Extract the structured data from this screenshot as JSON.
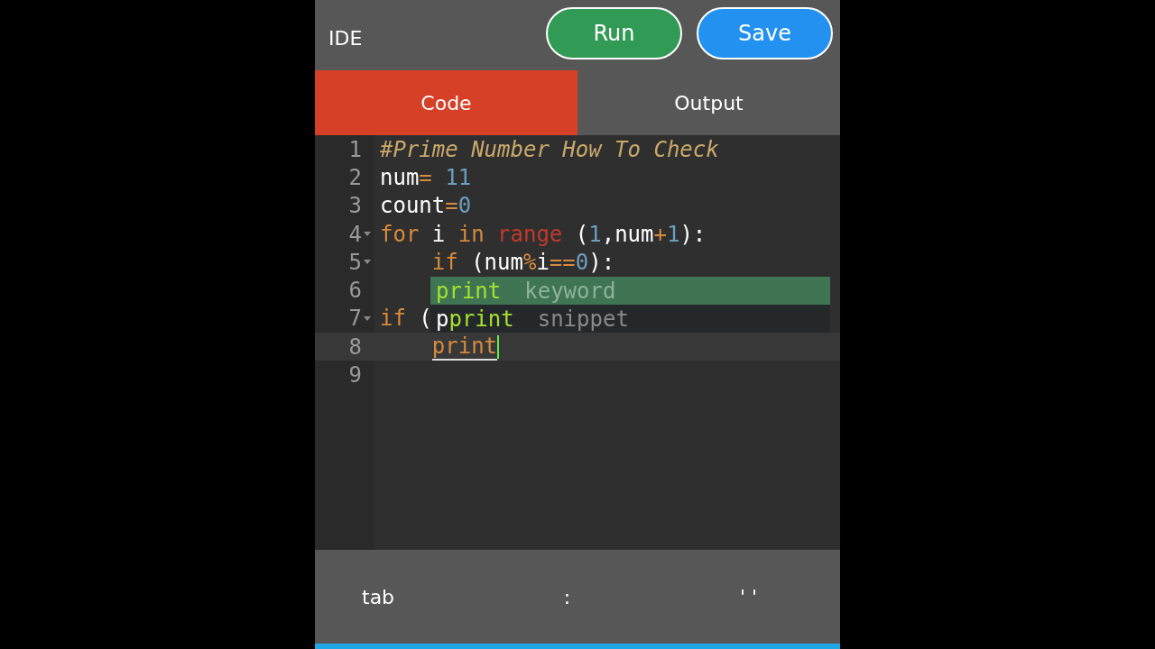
{
  "header": {
    "title": "IDE",
    "buttons": [
      {
        "label": "Run",
        "kind": "run"
      },
      {
        "label": "Save",
        "kind": "save"
      }
    ]
  },
  "tabs": [
    {
      "label": "Code",
      "selected": true
    },
    {
      "label": "Output",
      "selected": false
    }
  ],
  "editor": {
    "lines": [
      {
        "number": "1",
        "foldable": false,
        "active": false,
        "indented": false,
        "tokens": [
          {
            "text": "#Prime Number How To Check",
            "kind": "comment"
          }
        ]
      },
      {
        "number": "2",
        "foldable": false,
        "active": false,
        "indented": false,
        "tokens": [
          {
            "text": "num",
            "kind": "plain"
          },
          {
            "text": "=",
            "kind": "operator"
          },
          {
            "text": " 11",
            "kind": "number"
          }
        ]
      },
      {
        "number": "3",
        "foldable": false,
        "active": false,
        "indented": false,
        "tokens": [
          {
            "text": "count",
            "kind": "plain"
          },
          {
            "text": "=",
            "kind": "operator"
          },
          {
            "text": "0",
            "kind": "number"
          }
        ]
      },
      {
        "number": "4",
        "foldable": true,
        "active": false,
        "indented": false,
        "tokens": [
          {
            "text": "for",
            "kind": "keyword"
          },
          {
            "text": " i ",
            "kind": "plain"
          },
          {
            "text": "in",
            "kind": "keyword"
          },
          {
            "text": " range",
            "kind": "builtin"
          },
          {
            "text": " (",
            "kind": "plain"
          },
          {
            "text": "1",
            "kind": "number"
          },
          {
            "text": ",num",
            "kind": "plain"
          },
          {
            "text": "+",
            "kind": "operator"
          },
          {
            "text": "1",
            "kind": "number"
          },
          {
            "text": "):",
            "kind": "plain"
          }
        ]
      },
      {
        "number": "5",
        "foldable": true,
        "active": false,
        "indented": true,
        "tokens": [
          {
            "text": "if",
            "kind": "keyword"
          },
          {
            "text": " (num",
            "kind": "plain"
          },
          {
            "text": "%",
            "kind": "operator"
          },
          {
            "text": "i",
            "kind": "plain"
          },
          {
            "text": "==",
            "kind": "operator"
          },
          {
            "text": "0",
            "kind": "number"
          },
          {
            "text": "):",
            "kind": "plain"
          }
        ]
      },
      {
        "number": "6",
        "foldable": false,
        "active": false
      },
      {
        "number": "7",
        "foldable": true,
        "active": false,
        "indented": false,
        "tokens": [
          {
            "text": "if",
            "kind": "keyword"
          },
          {
            "text": " (",
            "kind": "plain"
          }
        ]
      },
      {
        "number": "8",
        "foldable": false,
        "active": true,
        "indented": true,
        "tokens": [
          {
            "text": "print",
            "kind": "typed"
          }
        ]
      },
      {
        "number": "9",
        "foldable": false,
        "active": false
      }
    ],
    "suggestions": [
      {
        "match": "print",
        "type": "keyword",
        "selected": true
      },
      {
        "before": "p",
        "match": "print",
        "type": "snippet",
        "selected": false
      }
    ]
  },
  "keyboard_bar": {
    "keys": [
      "tab",
      ":",
      "' '"
    ]
  }
}
